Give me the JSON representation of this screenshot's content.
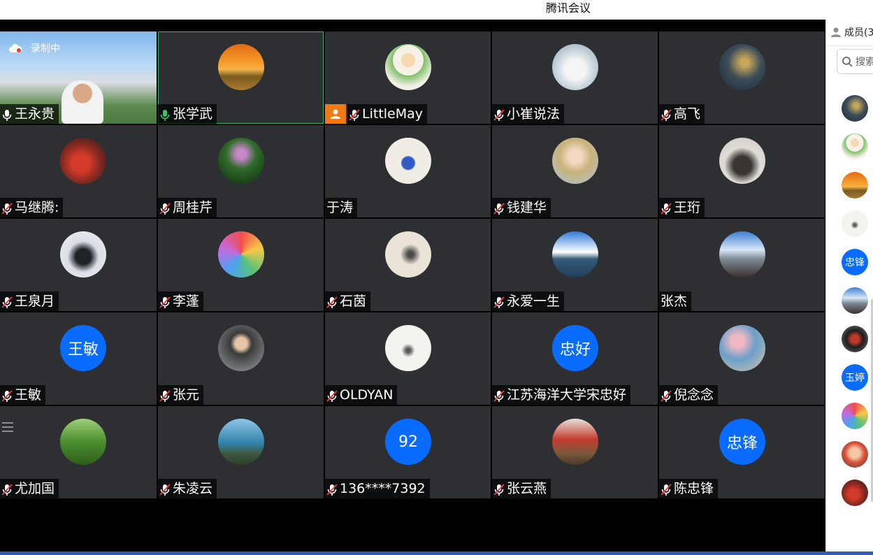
{
  "window": {
    "title": "腾讯会议"
  },
  "recording": {
    "label": "录制中"
  },
  "sidebar": {
    "members_label": "成员(3",
    "search_placeholder": "搜索"
  },
  "colors": {
    "stage": "#000000",
    "tile": "#2d2f33",
    "accent_blue": "#0a6cff",
    "host_orange": "#f07a13",
    "speaking_green": "#3fb06a",
    "muted_red": "#e03c3c"
  },
  "participants": [
    {
      "name": "王永贵",
      "mic": "on",
      "avatar": "video"
    },
    {
      "name": "张学武",
      "mic": "speaking",
      "avatar": "sunset"
    },
    {
      "name": "LittleMay",
      "mic": "muted",
      "avatar": "cartoon",
      "host": true
    },
    {
      "name": "小崔说法",
      "mic": "muted",
      "avatar": "seal"
    },
    {
      "name": "高飞",
      "mic": "muted",
      "avatar": "night"
    },
    {
      "name": "马继腾:",
      "mic": "muted",
      "avatar": "red"
    },
    {
      "name": "周桂芹",
      "mic": "muted",
      "avatar": "flower"
    },
    {
      "name": "于涛",
      "mic": "none",
      "avatar": "cat"
    },
    {
      "name": "钱建华",
      "mic": "muted",
      "avatar": "doll"
    },
    {
      "name": "王珩",
      "mic": "muted",
      "avatar": "girl"
    },
    {
      "name": "王泉月",
      "mic": "muted",
      "avatar": "person"
    },
    {
      "name": "李蓬",
      "mic": "muted",
      "avatar": "colorful"
    },
    {
      "name": "石茵",
      "mic": "muted",
      "avatar": "paint"
    },
    {
      "name": "永爱一生",
      "mic": "muted",
      "avatar": "sky"
    },
    {
      "name": "张杰",
      "mic": "none",
      "avatar": "mountain"
    },
    {
      "name": "王敏",
      "mic": "muted",
      "avatar_text": "王敏"
    },
    {
      "name": "张元",
      "mic": "muted",
      "avatar": "man"
    },
    {
      "name": "OLDYAN",
      "mic": "muted",
      "avatar": "branch"
    },
    {
      "name": "江苏海洋大学宋忠好",
      "mic": "muted",
      "avatar_text": "忠好"
    },
    {
      "name": "倪念念",
      "mic": "muted",
      "avatar": "woman"
    },
    {
      "name": "尤加国",
      "mic": "muted",
      "avatar": "forest"
    },
    {
      "name": "朱凌云",
      "mic": "muted",
      "avatar": "lake"
    },
    {
      "name": "136****7392",
      "mic": "muted",
      "avatar_text": "92"
    },
    {
      "name": "张云燕",
      "mic": "muted",
      "avatar": "room"
    },
    {
      "name": "陈忠锋",
      "mic": "muted",
      "avatar_text": "忠锋"
    }
  ],
  "sidebar_avatars": [
    {
      "avatar": "night"
    },
    {
      "avatar": "cartoon"
    },
    {
      "avatar": "sunset"
    },
    {
      "avatar": "branch"
    },
    {
      "avatar_text": "忠锋"
    },
    {
      "avatar": "mountain"
    },
    {
      "avatar": "kids"
    },
    {
      "avatar_text": "玉婷"
    },
    {
      "avatar": "colorful"
    },
    {
      "avatar": "toy"
    },
    {
      "avatar": "red"
    }
  ]
}
